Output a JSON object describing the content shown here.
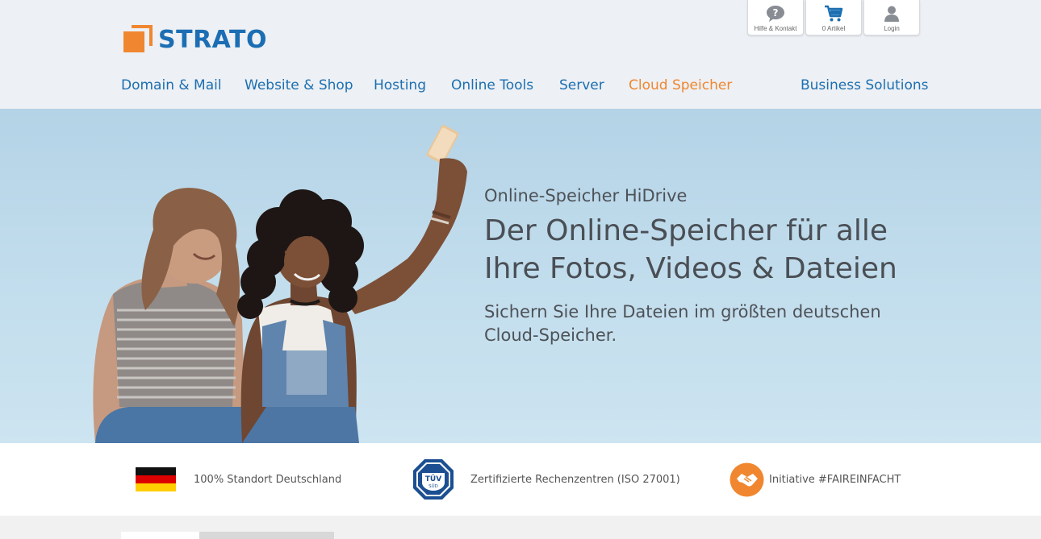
{
  "brand": {
    "name": "STRATO",
    "primary_color": "#1b6eb3",
    "accent_color": "#f08730"
  },
  "top_buttons": [
    {
      "icon": "help-icon",
      "label": "Hilfe & Kontakt"
    },
    {
      "icon": "cart-icon",
      "label": "0 Artikel"
    },
    {
      "icon": "user-icon",
      "label": "Login"
    }
  ],
  "nav": [
    {
      "label": "Domain & Mail",
      "active": false
    },
    {
      "label": "Website & Shop",
      "active": false
    },
    {
      "label": "Hosting",
      "active": false
    },
    {
      "label": "Online Tools",
      "active": false
    },
    {
      "label": "Server",
      "active": false
    },
    {
      "label": "Cloud Speicher",
      "active": true
    },
    {
      "label": "Business Solutions",
      "active": false
    }
  ],
  "hero": {
    "eyebrow": "Online-Speicher HiDrive",
    "title_line1": "Der Online-Speicher für alle",
    "title_line2": "Ihre Fotos, Videos & Dateien",
    "subtitle": "Sichern Sie Ihre Dateien im größten deutschen Cloud-Speicher."
  },
  "trust": [
    {
      "icon": "germany-flag-icon",
      "label": "100% Standort Deutschland"
    },
    {
      "icon": "tuv-badge-icon",
      "label": "Zertifizierte Rechenzentren (ISO 27001)",
      "badge_text_top": "TÜV",
      "badge_text_bottom": "SÜD"
    },
    {
      "icon": "handshake-icon",
      "label": "Initiative #FAIREINFACHT"
    }
  ]
}
